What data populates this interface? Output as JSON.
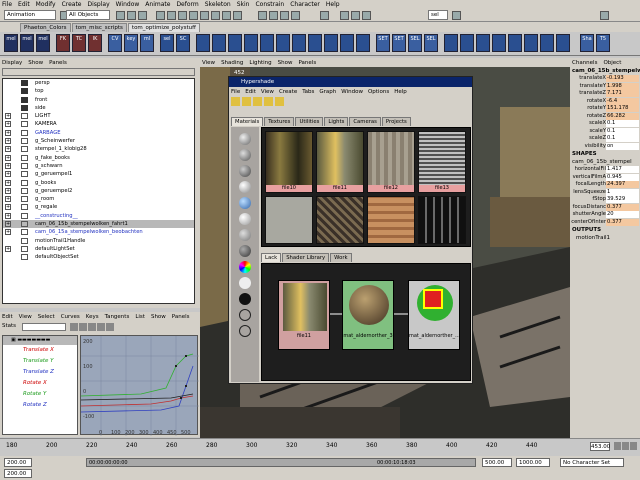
{
  "menubar": [
    "File",
    "Edit",
    "Modify",
    "Create",
    "Display",
    "Window",
    "Animate",
    "Deform",
    "Skeleton",
    "Skin",
    "Constrain",
    "Character",
    "Help"
  ],
  "status": {
    "mode": "Animation",
    "mask": "All Objects",
    "sel": "sel"
  },
  "shelf": {
    "tabs": [
      "Phaeton_Colors",
      "tom_misc_scripts",
      "tom_optimize_polystuff"
    ],
    "icons": [
      "mel",
      "mel",
      "mel",
      "FK",
      "TC",
      "IK",
      "CV",
      "key",
      "ml",
      "sel",
      "SC",
      "SET",
      "SET",
      "SEL",
      "SEL",
      "Sha",
      "T5"
    ]
  },
  "outliner": {
    "menu": [
      "Display",
      "Show",
      "Panels"
    ],
    "items": [
      {
        "label": "persp",
        "exp": ""
      },
      {
        "label": "top",
        "exp": ""
      },
      {
        "label": "front",
        "exp": ""
      },
      {
        "label": "side",
        "exp": ""
      },
      {
        "label": "LIGHT",
        "exp": "+"
      },
      {
        "label": "KAMERA",
        "exp": "+"
      },
      {
        "label": "GARBAGE",
        "exp": "+"
      },
      {
        "label": "g_Scheinwerfer",
        "exp": "+"
      },
      {
        "label": "stempel_1_klobig28",
        "exp": "+"
      },
      {
        "label": "g_fake_books",
        "exp": "+"
      },
      {
        "label": "g_schwarn",
        "exp": "+"
      },
      {
        "label": "g_geruempel1",
        "exp": "+"
      },
      {
        "label": "g_books",
        "exp": "+"
      },
      {
        "label": "g_geruempel2",
        "exp": "+"
      },
      {
        "label": "g_room",
        "exp": "+"
      },
      {
        "label": "g_regale",
        "exp": "+"
      },
      {
        "label": "__constructing__",
        "exp": "+"
      },
      {
        "label": "cam_06_15b_stempelwolken_fahrt1",
        "exp": "+"
      },
      {
        "label": "cam_06_15a_stempelwolken_beobachten",
        "exp": "+"
      },
      {
        "label": "motionTrail1Handle",
        "exp": ""
      },
      {
        "label": "defaultLightSet",
        "exp": "+"
      },
      {
        "label": "defaultObjectSet",
        "exp": ""
      }
    ]
  },
  "graph": {
    "menu": [
      "Edit",
      "View",
      "Select",
      "Curves",
      "Keys",
      "Tangents",
      "List",
      "Show",
      "Panels"
    ],
    "stats": "Stats",
    "channels": [
      "Translate X",
      "Translate Y",
      "Translate Z",
      "Rotate X",
      "Rotate Y",
      "Rotate Z"
    ],
    "xticks": [
      "0",
      "100",
      "200",
      "300",
      "400",
      "450",
      "500"
    ],
    "yticks": [
      "200",
      "100",
      "0",
      "-100"
    ]
  },
  "viewport": {
    "menu": [
      "View",
      "Shading",
      "Lighting",
      "Show",
      "Panels"
    ],
    "frame": "452",
    "hypershade": {
      "title": "Hypershade",
      "menu": [
        "File",
        "Edit",
        "View",
        "Create",
        "Tabs",
        "Graph",
        "Window",
        "Options",
        "Help"
      ],
      "tabs": [
        "Materials",
        "Textures",
        "Utilities",
        "Lights",
        "Cameras",
        "Projects"
      ],
      "textures": [
        "file10",
        "file11",
        "file12",
        "file13"
      ],
      "worktabs": [
        "Lack",
        "Shader Library",
        "Work"
      ],
      "nodes": [
        "file11",
        "mat_aldernorther_3",
        "mat_aldernorther_..."
      ]
    }
  },
  "channelbox": {
    "tabs": [
      "Channels",
      "Object"
    ],
    "object": "cam_06_15b_stempelw",
    "attrs": [
      [
        "translateX",
        "-0.193"
      ],
      [
        "translateY",
        "1.998"
      ],
      [
        "translateZ",
        "7.171"
      ],
      [
        "rotateX",
        "-6.4"
      ],
      [
        "rotateY",
        "151.178"
      ],
      [
        "rotateZ",
        "66.282"
      ],
      [
        "scaleX",
        "0.1"
      ],
      [
        "scaleY",
        "0.1"
      ],
      [
        "scaleZ",
        "0.1"
      ],
      [
        "visibility",
        "on"
      ]
    ],
    "shapes": "SHAPES",
    "shape": "cam_06_15b_stempel",
    "shapeattrs": [
      [
        "horizontalFil",
        "1.417"
      ],
      [
        "verticalFilmA",
        "0.945"
      ],
      [
        "focalLength",
        "24.397"
      ],
      [
        "lensSqueeze",
        "1"
      ],
      [
        "fStop",
        "39.529"
      ],
      [
        "focusDistanc",
        "0.377"
      ],
      [
        "shutterAngle",
        "20"
      ],
      [
        "centerOfInter",
        "0.377"
      ]
    ],
    "outputs": "OUTPUTS",
    "output": "motionTrail1"
  },
  "timeline": {
    "ticks": [
      "180",
      "200",
      "220",
      "240",
      "260",
      "280",
      "300",
      "320",
      "340",
      "360",
      "380",
      "400",
      "420",
      "440"
    ],
    "current": "453.00"
  },
  "range": {
    "start": "200.00",
    "startin": "200.00",
    "end": "500.00",
    "endout": "1000.00",
    "char": "No Character Set",
    "t1": "00:00:10:18:03",
    "t2": "00:00:00:00:00"
  },
  "colors": {
    "selection": "#b8b8b8",
    "key": "#cc0000",
    "titlebar": "#0a246a"
  }
}
